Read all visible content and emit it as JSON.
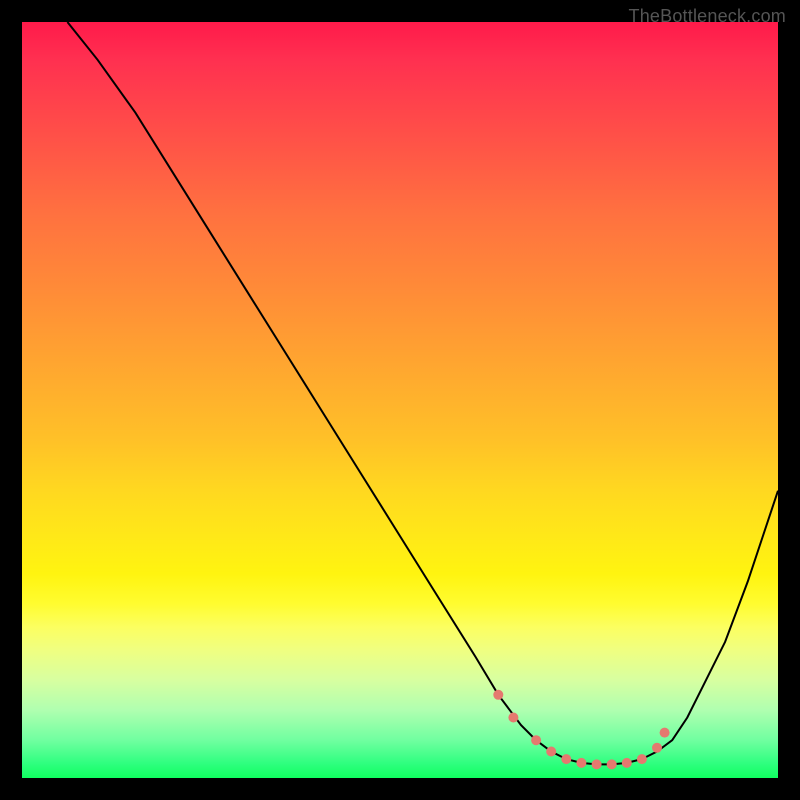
{
  "watermark": "TheBottleneck.com",
  "chart_data": {
    "type": "line",
    "title": "",
    "xlabel": "",
    "ylabel": "",
    "xlim": [
      0,
      100
    ],
    "ylim": [
      0,
      100
    ],
    "series": [
      {
        "name": "curve",
        "x": [
          6,
          10,
          15,
          20,
          25,
          30,
          35,
          40,
          45,
          50,
          55,
          60,
          63,
          66,
          68,
          70,
          72,
          74,
          76,
          78,
          80,
          82,
          84,
          86,
          88,
          90,
          93,
          96,
          100
        ],
        "y": [
          100,
          95,
          88,
          80,
          72,
          64,
          56,
          48,
          40,
          32,
          24,
          16,
          11,
          7,
          5,
          3.5,
          2.5,
          2,
          1.8,
          1.8,
          2,
          2.5,
          3.5,
          5,
          8,
          12,
          18,
          26,
          38
        ]
      },
      {
        "name": "dots",
        "type": "scatter",
        "x": [
          63,
          65,
          68,
          70,
          72,
          74,
          76,
          78,
          80,
          82,
          84,
          85
        ],
        "y": [
          11,
          8,
          5,
          3.5,
          2.5,
          2,
          1.8,
          1.8,
          2,
          2.5,
          4,
          6
        ]
      }
    ],
    "colors": {
      "curve": "#000000",
      "dots": "#e5796f"
    }
  }
}
